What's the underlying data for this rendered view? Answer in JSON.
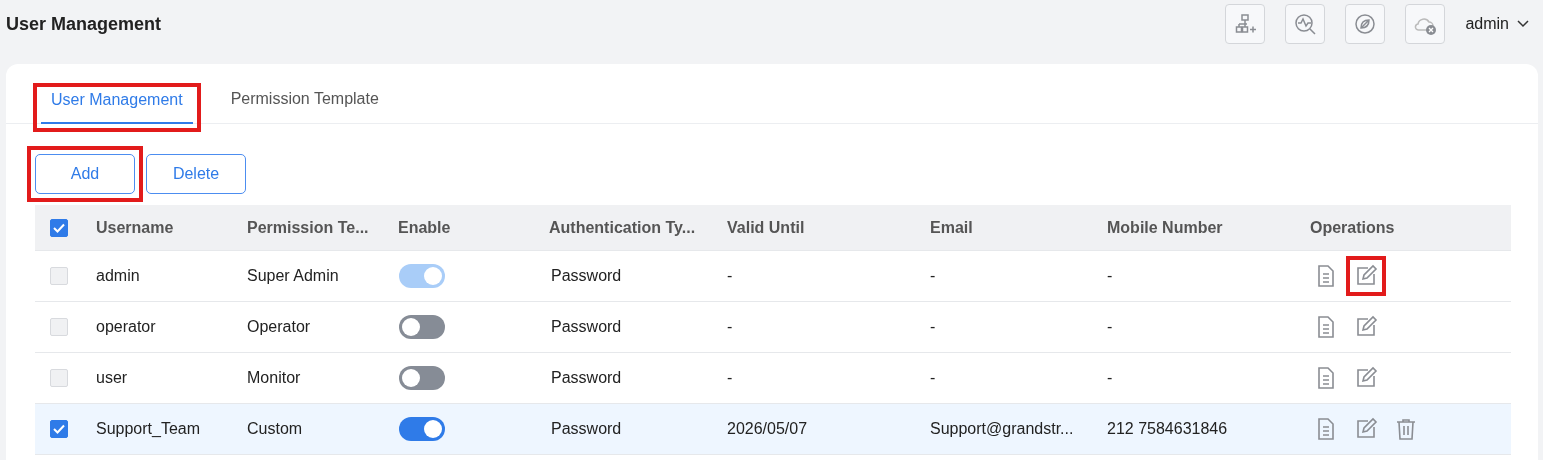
{
  "header": {
    "title": "User Management",
    "user": "admin"
  },
  "tabs": [
    {
      "label": "User Management",
      "selected": true,
      "highlighted": true
    },
    {
      "label": "Permission Template",
      "selected": false,
      "highlighted": false
    }
  ],
  "buttons": [
    {
      "label": "Add",
      "highlighted": true
    },
    {
      "label": "Delete",
      "highlighted": false
    }
  ],
  "table": {
    "select_all_checked": true,
    "columns": [
      "Username",
      "Permission Te...",
      "Enable",
      "Authentication Ty...",
      "Valid Until",
      "Email",
      "Mobile Number",
      "Operations"
    ],
    "rows": [
      {
        "selected": false,
        "checkbox_disabled": true,
        "username": "admin",
        "permission": "Super Admin",
        "enabled": true,
        "enable_disabled": true,
        "auth": "Password",
        "valid_until": "-",
        "email": "-",
        "mobile": "-",
        "operations": [
          {
            "kind": "view",
            "highlighted": false
          },
          {
            "kind": "edit",
            "highlighted": true
          }
        ]
      },
      {
        "selected": false,
        "checkbox_disabled": true,
        "username": "operator",
        "permission": "Operator",
        "enabled": false,
        "enable_disabled": false,
        "auth": "Password",
        "valid_until": "-",
        "email": "-",
        "mobile": "-",
        "operations": [
          {
            "kind": "view",
            "highlighted": false
          },
          {
            "kind": "edit",
            "highlighted": false
          }
        ]
      },
      {
        "selected": false,
        "checkbox_disabled": true,
        "username": "user",
        "permission": "Monitor",
        "enabled": false,
        "enable_disabled": false,
        "auth": "Password",
        "valid_until": "-",
        "email": "-",
        "mobile": "-",
        "operations": [
          {
            "kind": "view",
            "highlighted": false
          },
          {
            "kind": "edit",
            "highlighted": false
          }
        ]
      },
      {
        "selected": true,
        "checkbox_disabled": false,
        "username": "Support_Team",
        "permission": "Custom",
        "enabled": true,
        "enable_disabled": false,
        "auth": "Password",
        "valid_until": "2026/05/07",
        "email": "Support@grandstr...",
        "mobile": "212 7584631846",
        "operations": [
          {
            "kind": "view",
            "highlighted": false
          },
          {
            "kind": "edit",
            "highlighted": false
          },
          {
            "kind": "delete",
            "highlighted": false
          }
        ]
      }
    ]
  }
}
